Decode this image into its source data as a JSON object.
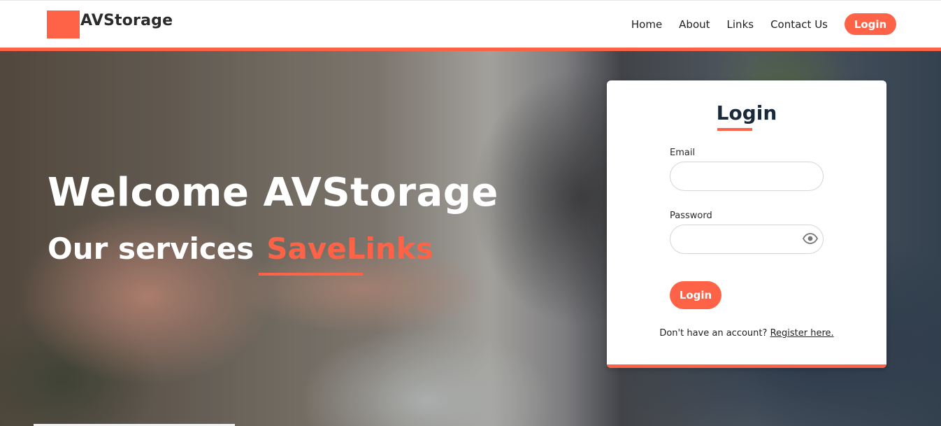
{
  "brand": {
    "name": "AVStorage",
    "accent_color": "#ff6347"
  },
  "nav": {
    "links": [
      "Home",
      "About",
      "Links",
      "Contact Us"
    ],
    "login_label": "Login"
  },
  "hero": {
    "title": "Welcome AVStorage",
    "subtitle_prefix": "Our services",
    "subtitle_accent": "SaveLinks"
  },
  "login_form": {
    "title": "Login",
    "email_label": "Email",
    "email_value": "",
    "password_label": "Password",
    "password_value": "",
    "password_toggle_icon": "eye-icon",
    "submit_label": "Login",
    "register_prompt": "Don't have an account?",
    "register_link": "Register here."
  }
}
